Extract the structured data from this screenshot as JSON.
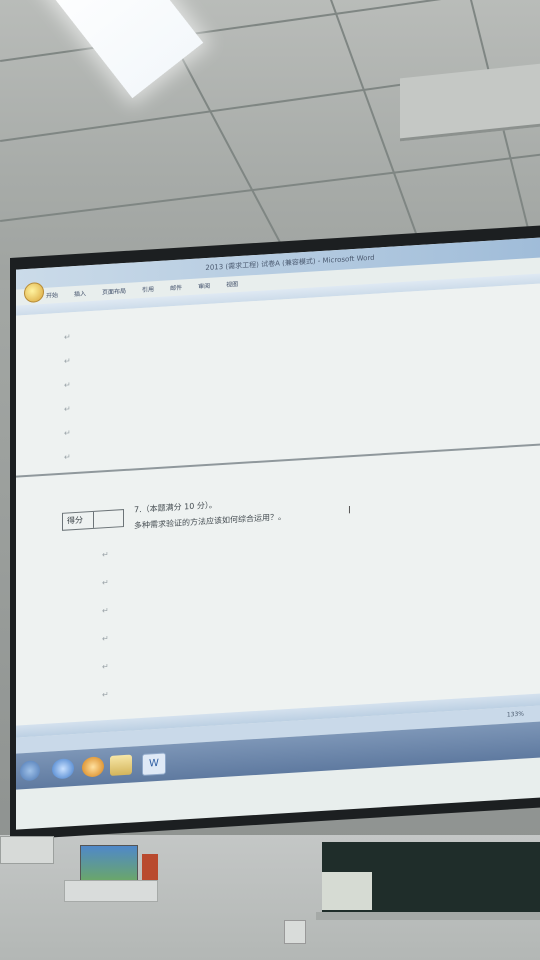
{
  "window": {
    "title": "2013 (需求工程) 试卷A (兼容模式) - Microsoft Word"
  },
  "ribbon": {
    "tabs": [
      "开始",
      "插入",
      "页面布局",
      "引用",
      "邮件",
      "审阅",
      "视图"
    ]
  },
  "document": {
    "score_label": "得分",
    "score_value": "",
    "question_title": "7.（本题满分 10 分）。",
    "question_text": "多种需求验证的方法应该如何综合运用？。"
  },
  "statusbar": {
    "zoom": "133%"
  },
  "taskbar": {
    "icons": [
      "windows-start-icon",
      "browser-icon",
      "media-player-icon",
      "folder-icon",
      "word-icon"
    ],
    "word_icon_glyph": "W"
  },
  "colors": {
    "ribbon_blue": "#9ebbd8",
    "taskbar_blue": "#6a84a8",
    "screen_bg": "#e8eeed"
  }
}
